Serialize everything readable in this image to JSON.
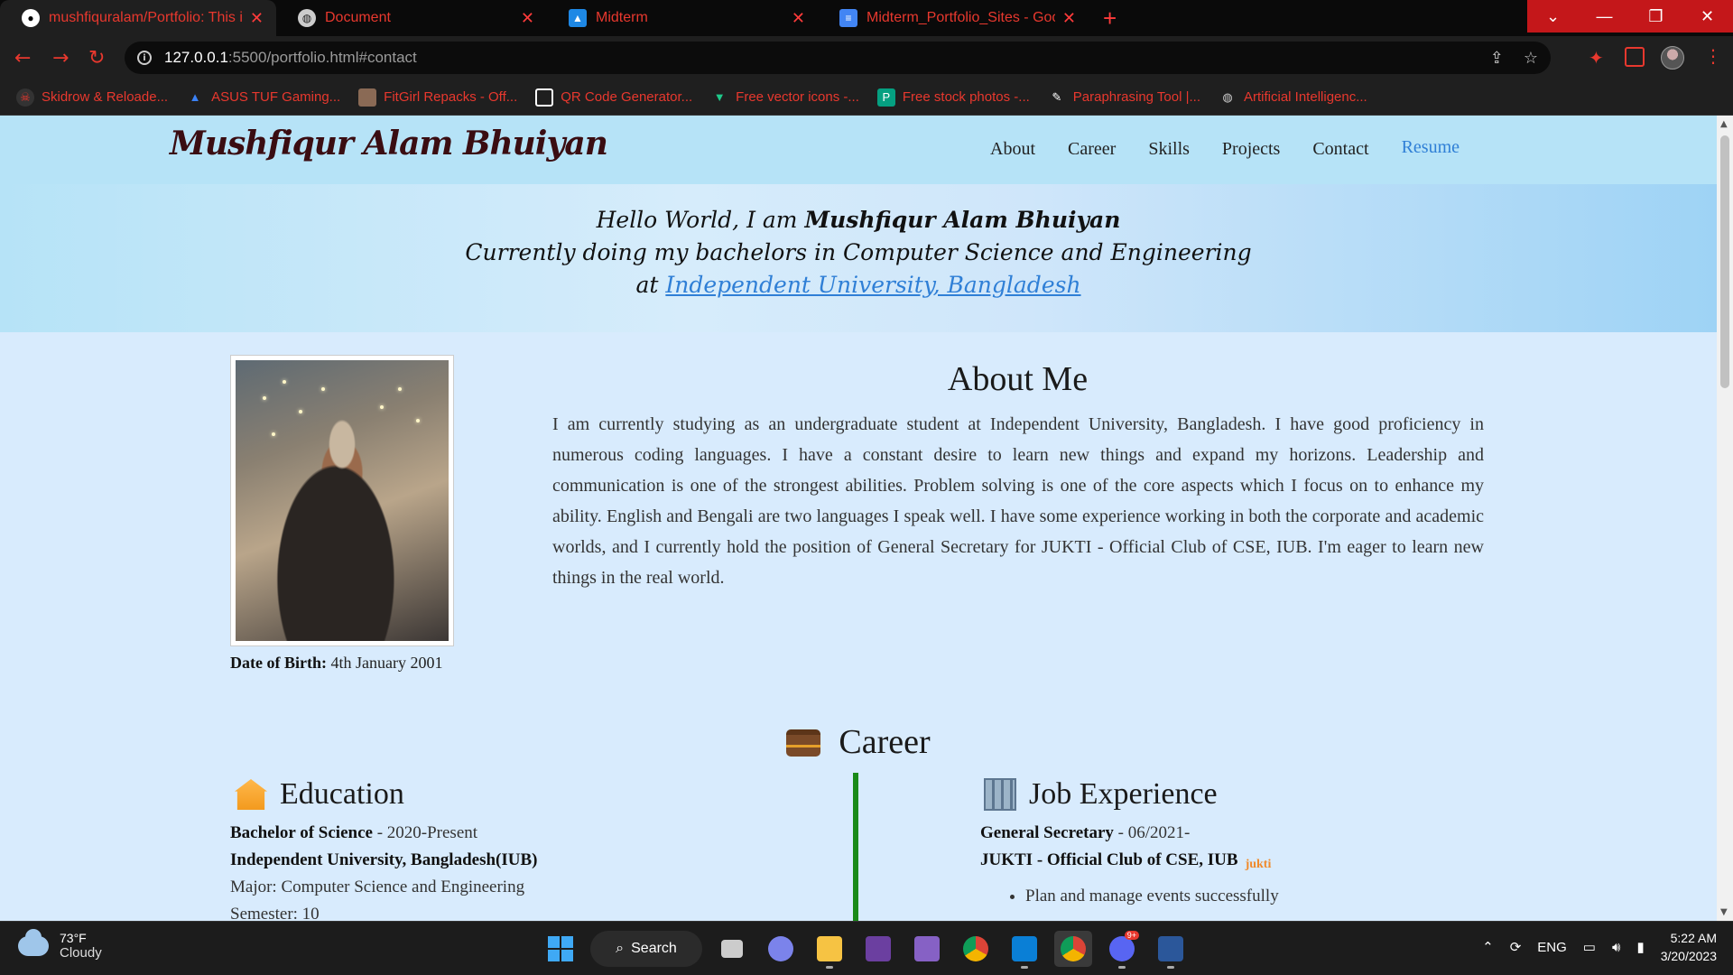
{
  "browser": {
    "tabs": [
      {
        "title": "mushfiquralam/Portfolio: This is a",
        "icon": "github-icon",
        "active": true
      },
      {
        "title": "Document",
        "icon": "globe-icon",
        "active": false
      },
      {
        "title": "Midterm",
        "icon": "classroom-icon",
        "active": false
      },
      {
        "title": "Midterm_Portfolio_Sites - Google",
        "icon": "docs-icon",
        "active": false
      }
    ],
    "new_tab": "+",
    "url_host": "127.0.0.1",
    "url_path": ":5500/portfolio.html#contact",
    "bookmarks": [
      {
        "label": "Skidrow & Reloade...",
        "icon": "skull-icon"
      },
      {
        "label": "ASUS TUF Gaming...",
        "icon": "asus-icon"
      },
      {
        "label": "FitGirl Repacks - Off...",
        "icon": "fitgirl-icon"
      },
      {
        "label": "QR Code Generator...",
        "icon": "qr-icon"
      },
      {
        "label": "Free vector icons -...",
        "icon": "vector-icon"
      },
      {
        "label": "Free stock photos -...",
        "icon": "pexels-icon"
      },
      {
        "label": "Paraphrasing Tool |...",
        "icon": "quill-icon"
      },
      {
        "label": "Artificial Intelligenc...",
        "icon": "globe-icon"
      }
    ]
  },
  "site": {
    "brand": "Mushfiqur Alam Bhuiyan",
    "nav": [
      "About",
      "Career",
      "Skills",
      "Projects",
      "Contact"
    ],
    "resume": "Resume",
    "hero": {
      "line1_prefix": "Hello World, I am ",
      "line1_name": "Mushfiqur Alam Bhuiyan",
      "line2": "Currently doing my bachelors in Computer Science and Engineering",
      "line3_prefix": "at ",
      "line3_link": "Independent University, Bangladesh"
    },
    "about": {
      "title": "About Me",
      "text": "I am currently studying as an undergraduate student at Independent University, Bangladesh. I have good proficiency in numerous coding languages. I have a constant desire to learn new things and expand my horizons. Leadership and communication is one of the strongest abilities. Problem solving is one of the core aspects which I focus on to enhance my ability. English and Bengali are two languages I speak well. I have some experience working in both the corporate and academic worlds, and I currently hold the position of General Secretary for JUKTI - Official Club of CSE, IUB. I'm eager to learn new things in the real world.",
      "dob_label": "Date of Birth:",
      "dob_value": "4th January 2001"
    },
    "career": {
      "title": "Career",
      "education": {
        "title": "Education",
        "degree": "Bachelor of Science",
        "degree_period": " - 2020-Present",
        "institution": "Independent University, Bangladesh(IUB)",
        "major": "Major: Computer Science and Engineering",
        "semester": "Semester: 10"
      },
      "job": {
        "title": "Job Experience",
        "role": "General Secretary",
        "role_period": " - 06/2021-",
        "org": "JUKTI - Official Club of CSE, IUB",
        "org_logo_text": "jukti",
        "bullets": [
          "Plan and manage events successfully"
        ]
      }
    }
  },
  "taskbar": {
    "temperature": "73°F",
    "condition": "Cloudy",
    "search": "Search",
    "language": "ENG",
    "time": "5:22 AM",
    "date": "3/20/2023",
    "discord_badge": "9+"
  },
  "colors": {
    "tab_text": "#e8382e",
    "page_bg": "#d8ebfd",
    "nav_bg": "#b6e3f7",
    "link": "#2f7fd6",
    "divider": "#1a8a18"
  }
}
